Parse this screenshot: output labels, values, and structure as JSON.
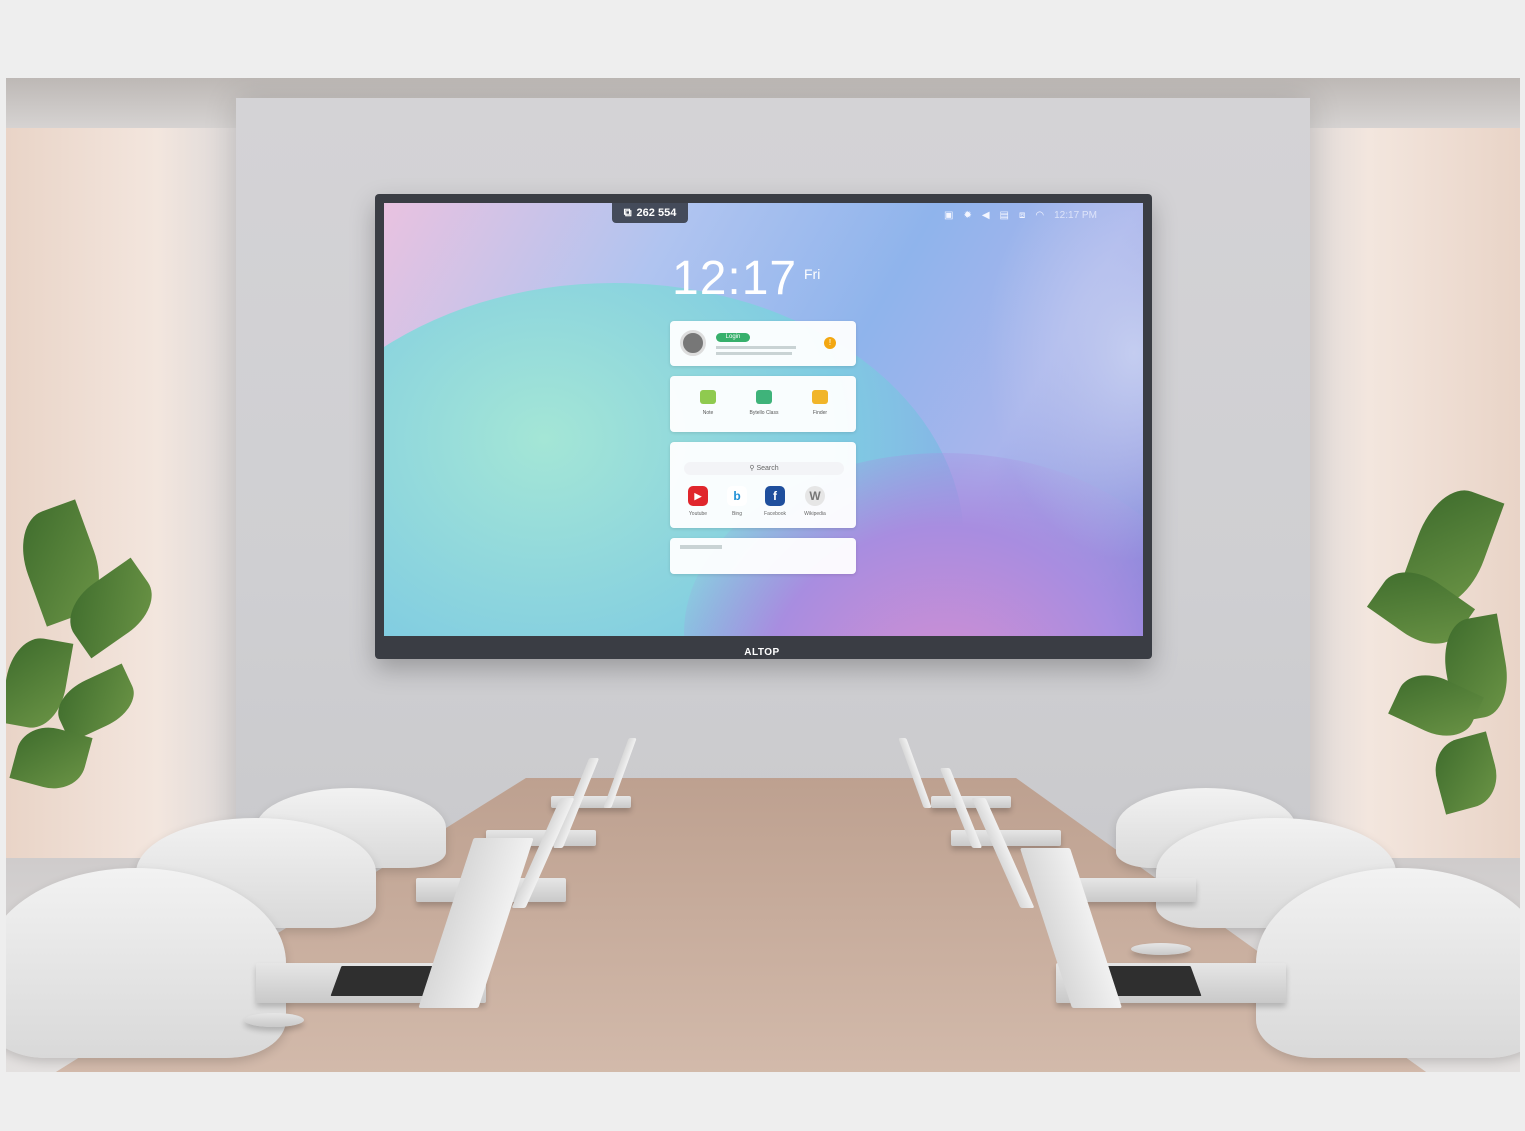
{
  "screen": {
    "meeting_id": "262 554",
    "clock_time": "12:17",
    "clock_day": "Fri",
    "status_time": "12:17 PM",
    "login_label": "Login",
    "search_label": "Search",
    "brand": "ALTOP"
  },
  "apps": [
    {
      "label": "Note",
      "color": "#8fca4f"
    },
    {
      "label": "Bytello Class",
      "color": "#3fb37a"
    },
    {
      "label": "Finder",
      "color": "#f1b52a"
    }
  ],
  "browser_shortcuts": [
    {
      "label": "Youtube",
      "glyph": "▶",
      "color": "#e0262c"
    },
    {
      "label": "Bing",
      "glyph": "b",
      "color": "#ffffff"
    },
    {
      "label": "Facebook",
      "glyph": "f",
      "color": "#1f4f9d"
    },
    {
      "label": "Wikipedia",
      "glyph": "W",
      "color": "#e6e6e6"
    }
  ],
  "icons": [
    "screen-icon",
    "brightness-icon",
    "volume-icon",
    "chat-icon",
    "network-icon",
    "wifi-icon"
  ]
}
